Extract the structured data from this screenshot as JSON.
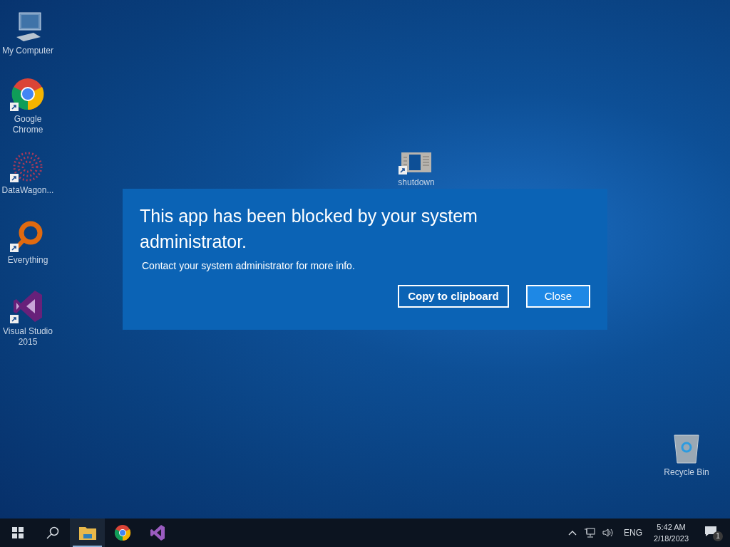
{
  "desktop_icons": [
    {
      "kind": "computer",
      "label": "My Computer",
      "shortcut": false
    },
    {
      "kind": "chrome",
      "label": "Google Chrome",
      "shortcut": true
    },
    {
      "kind": "datawagon",
      "label": "DataWagon...",
      "shortcut": true
    },
    {
      "kind": "everything",
      "label": "Everything",
      "shortcut": true
    },
    {
      "kind": "visualstudio",
      "label": "Visual Studio 2015",
      "shortcut": true
    },
    {
      "kind": "shutdown",
      "label": "shutdown",
      "shortcut": true
    },
    {
      "kind": "recycle",
      "label": "Recycle Bin",
      "shortcut": false
    }
  ],
  "dialog": {
    "title": "This app has been blocked by your system administrator.",
    "message": "Contact your system administrator for more info.",
    "buttons": [
      {
        "label": "Copy to clipboard",
        "selected": false
      },
      {
        "label": "Close",
        "selected": true
      }
    ]
  },
  "taskbar": {
    "items": [
      {
        "kind": "start",
        "active": false
      },
      {
        "kind": "search",
        "active": false
      },
      {
        "kind": "explorer",
        "active": true
      },
      {
        "kind": "chrome",
        "active": false
      },
      {
        "kind": "visualstudio",
        "active": false
      }
    ],
    "tray": {
      "language": "ENG",
      "time": "5:42 AM",
      "date": "2/18/2023",
      "notifications": "1"
    }
  }
}
